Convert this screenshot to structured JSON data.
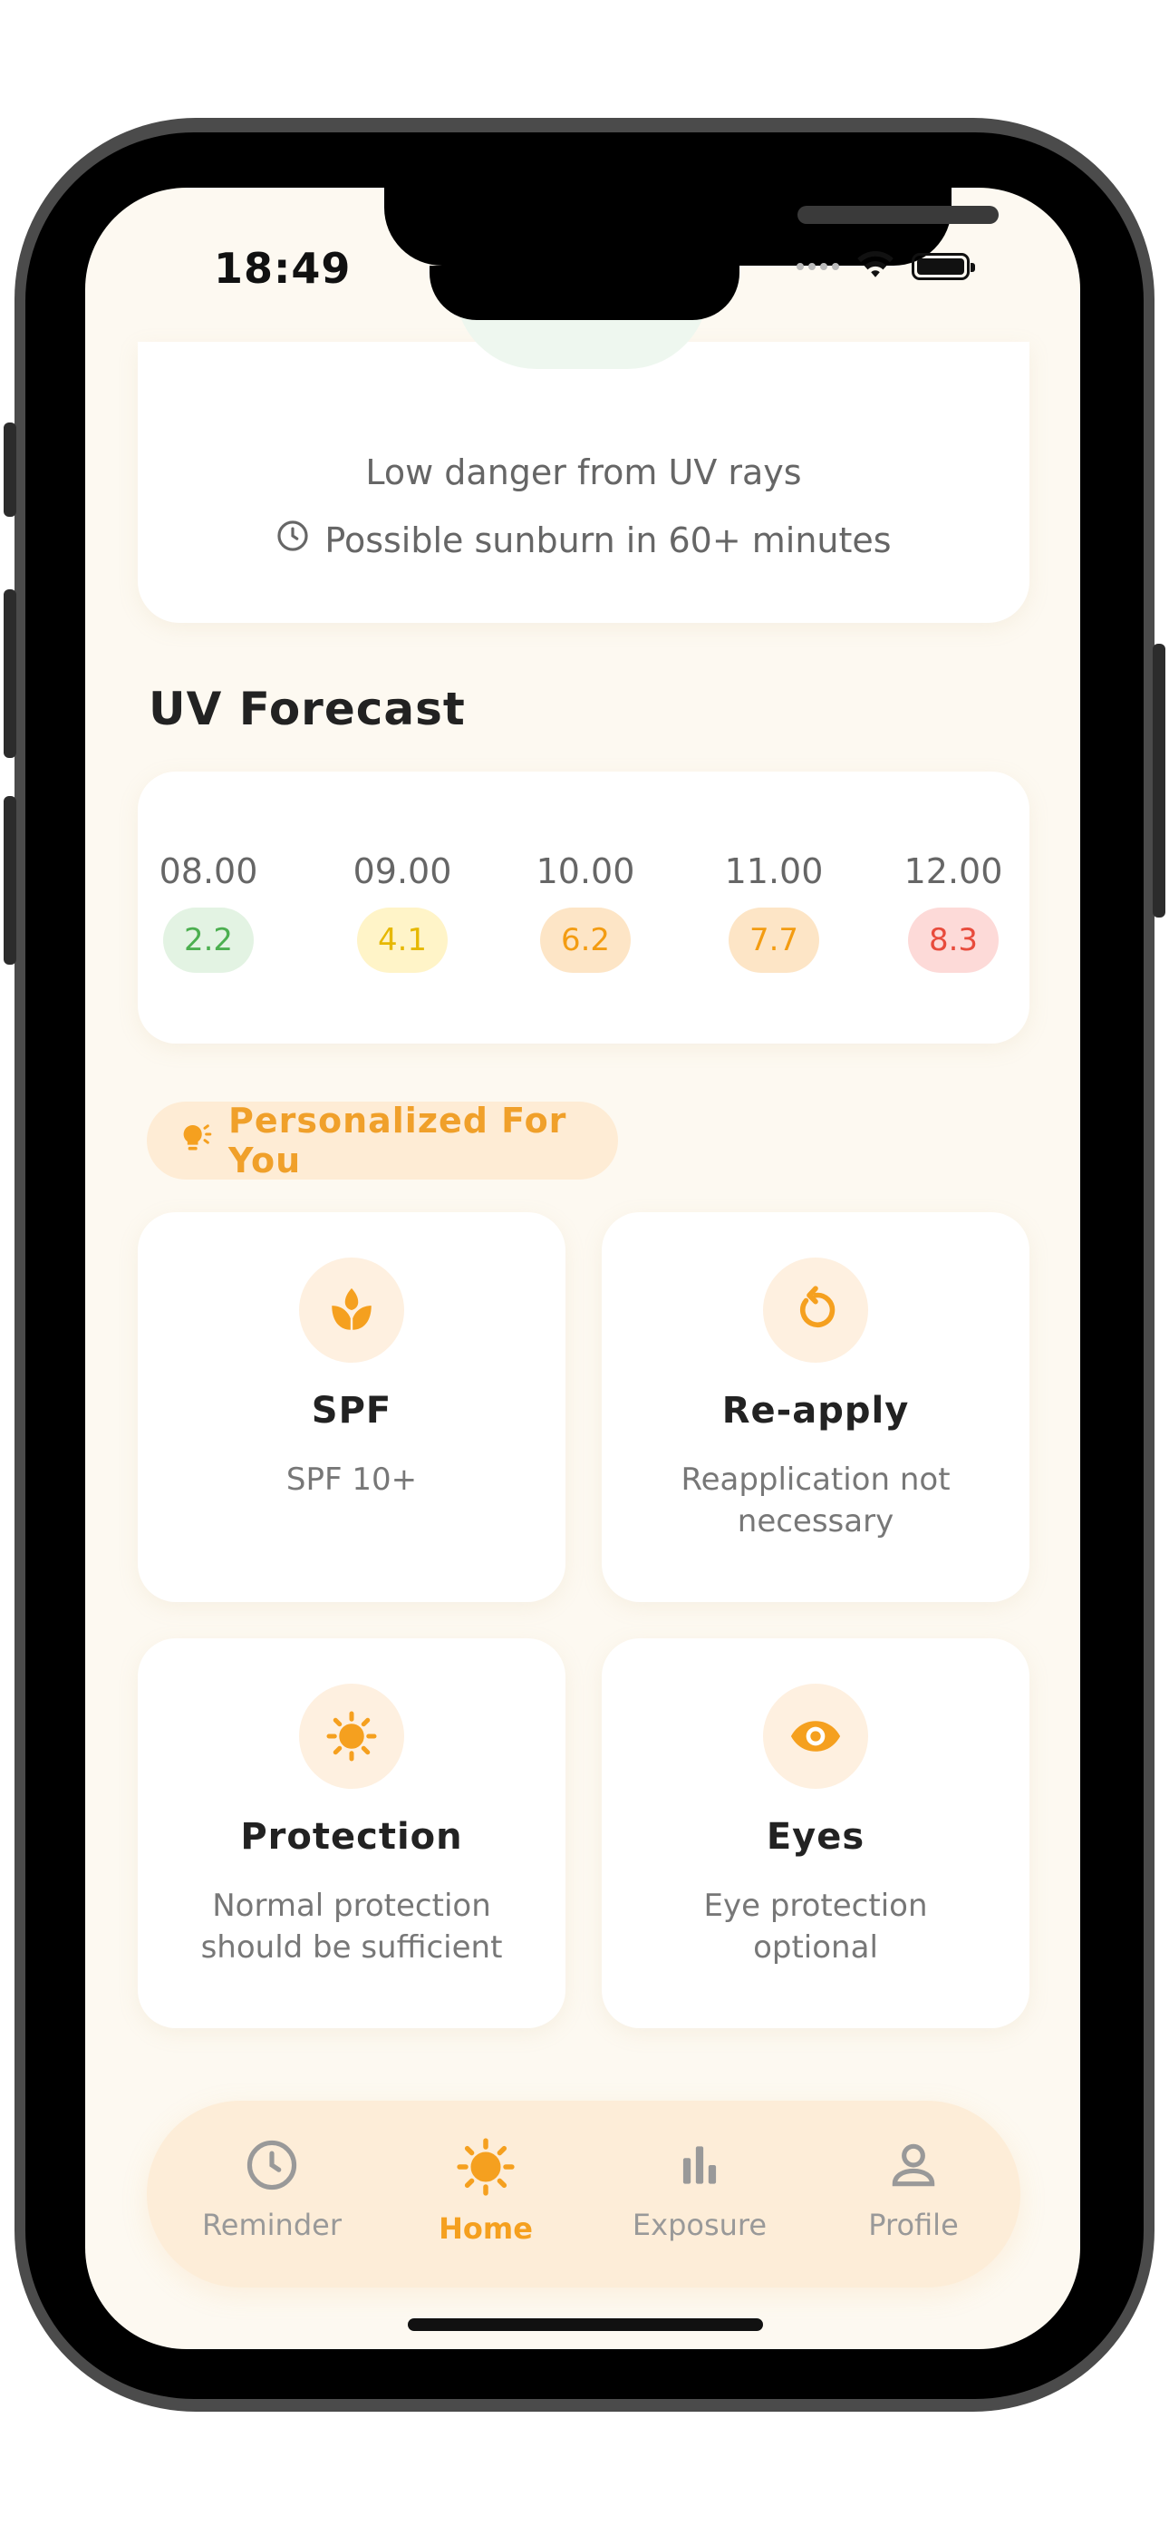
{
  "status_bar": {
    "time": "18:49"
  },
  "uv_card": {
    "danger_text": "Low danger from UV rays",
    "sunburn_text": "Possible sunburn in 60+ minutes",
    "icon": "clock-icon"
  },
  "forecast": {
    "title": "UV Forecast",
    "items": [
      {
        "time": "08.00",
        "value": "2.2",
        "bg": "#e3f3e3",
        "color": "#4caf50"
      },
      {
        "time": "09.00",
        "value": "4.1",
        "bg": "#fff4c8",
        "color": "#e6b800"
      },
      {
        "time": "10.00",
        "value": "6.2",
        "bg": "#fde5c6",
        "color": "#f39c12"
      },
      {
        "time": "11.00",
        "value": "7.7",
        "bg": "#fde5c6",
        "color": "#f39c12"
      },
      {
        "time": "12.00",
        "value": "8.3",
        "bg": "#fddad8",
        "color": "#e84b3c"
      }
    ]
  },
  "personalized": {
    "label": "Personalized For You",
    "icon": "lightbulb-icon",
    "tips": [
      {
        "title": "SPF",
        "desc": "SPF 10+",
        "icon": "leaf-icon"
      },
      {
        "title": "Re-apply",
        "desc": "Reapplication not necessary",
        "icon": "reapply-icon"
      },
      {
        "title": "Protection",
        "desc": "Normal protection should be sufficient",
        "icon": "sun-icon"
      },
      {
        "title": "Eyes",
        "desc": "Eye protection optional",
        "icon": "eye-icon"
      }
    ]
  },
  "nav": {
    "items": [
      {
        "label": "Reminder",
        "icon": "clock-icon",
        "active": false
      },
      {
        "label": "Home",
        "icon": "sun-icon",
        "active": true
      },
      {
        "label": "Exposure",
        "icon": "bar-chart-icon",
        "active": false
      },
      {
        "label": "Profile",
        "icon": "person-icon",
        "active": false
      }
    ]
  },
  "colors": {
    "accent": "#f5a01f",
    "background": "#fdf9f1",
    "muted": "#999999"
  }
}
